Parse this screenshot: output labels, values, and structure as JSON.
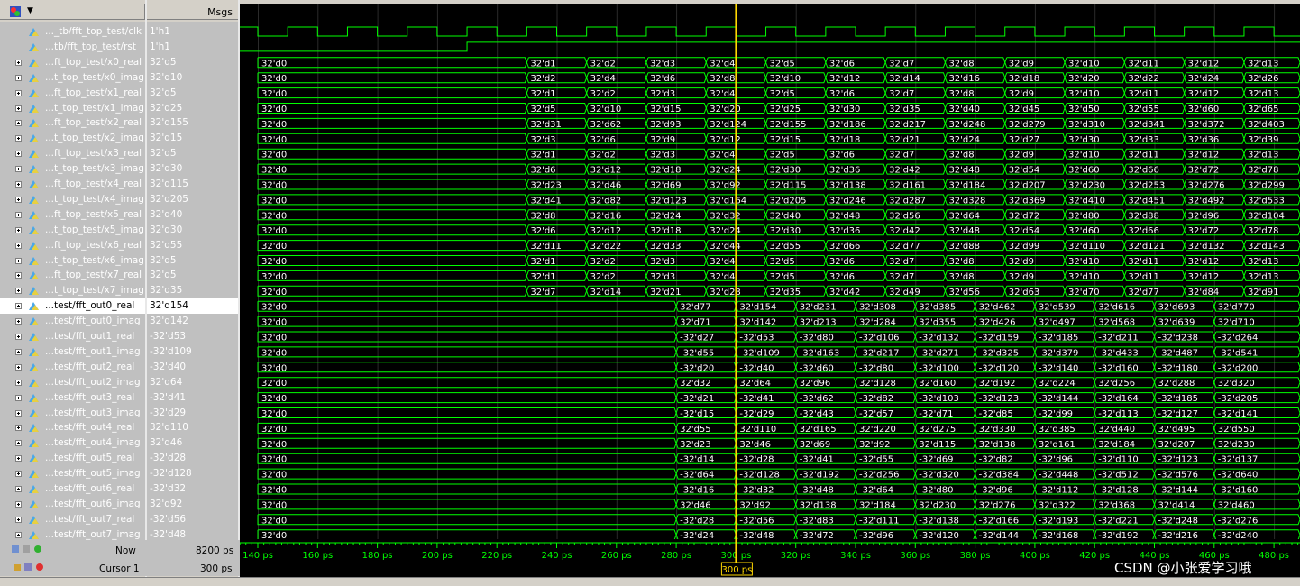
{
  "header": {
    "msgs_label": "Msgs"
  },
  "signals": [
    {
      "name": "..._tb/fft_top_test/clk",
      "value": "1'h1",
      "expandable": false
    },
    {
      "name": "...tb/fft_top_test/rst",
      "value": "1'h1",
      "expandable": false
    },
    {
      "name": "...ft_top_test/x0_real",
      "value": "32'd5",
      "expandable": true
    },
    {
      "name": "...t_top_test/x0_imag",
      "value": "32'd10",
      "expandable": true
    },
    {
      "name": "...ft_top_test/x1_real",
      "value": "32'd5",
      "expandable": true
    },
    {
      "name": "...t_top_test/x1_imag",
      "value": "32'd25",
      "expandable": true
    },
    {
      "name": "...ft_top_test/x2_real",
      "value": "32'd155",
      "expandable": true
    },
    {
      "name": "...t_top_test/x2_imag",
      "value": "32'd15",
      "expandable": true
    },
    {
      "name": "...ft_top_test/x3_real",
      "value": "32'd5",
      "expandable": true
    },
    {
      "name": "...t_top_test/x3_imag",
      "value": "32'd30",
      "expandable": true
    },
    {
      "name": "...ft_top_test/x4_real",
      "value": "32'd115",
      "expandable": true
    },
    {
      "name": "...t_top_test/x4_imag",
      "value": "32'd205",
      "expandable": true
    },
    {
      "name": "...ft_top_test/x5_real",
      "value": "32'd40",
      "expandable": true
    },
    {
      "name": "...t_top_test/x5_imag",
      "value": "32'd30",
      "expandable": true
    },
    {
      "name": "...ft_top_test/x6_real",
      "value": "32'd55",
      "expandable": true
    },
    {
      "name": "...t_top_test/x6_imag",
      "value": "32'd5",
      "expandable": true
    },
    {
      "name": "...ft_top_test/x7_real",
      "value": "32'd5",
      "expandable": true
    },
    {
      "name": "...t_top_test/x7_imag",
      "value": "32'd35",
      "expandable": true
    },
    {
      "name": "...test/fft_out0_real",
      "value": "32'd154",
      "expandable": true,
      "selected": true
    },
    {
      "name": "...test/fft_out0_imag",
      "value": "32'd142",
      "expandable": true
    },
    {
      "name": "...test/fft_out1_real",
      "value": "-32'd53",
      "expandable": true
    },
    {
      "name": "...test/fft_out1_imag",
      "value": "-32'd109",
      "expandable": true
    },
    {
      "name": "...test/fft_out2_real",
      "value": "-32'd40",
      "expandable": true
    },
    {
      "name": "...test/fft_out2_imag",
      "value": "32'd64",
      "expandable": true
    },
    {
      "name": "...test/fft_out3_real",
      "value": "-32'd41",
      "expandable": true
    },
    {
      "name": "...test/fft_out3_imag",
      "value": "-32'd29",
      "expandable": true
    },
    {
      "name": "...test/fft_out4_real",
      "value": "32'd110",
      "expandable": true
    },
    {
      "name": "...test/fft_out4_imag",
      "value": "32'd46",
      "expandable": true
    },
    {
      "name": "...test/fft_out5_real",
      "value": "-32'd28",
      "expandable": true
    },
    {
      "name": "...test/fft_out5_imag",
      "value": "-32'd128",
      "expandable": true
    },
    {
      "name": "...test/fft_out6_real",
      "value": "-32'd32",
      "expandable": true
    },
    {
      "name": "...test/fft_out6_imag",
      "value": "32'd92",
      "expandable": true
    },
    {
      "name": "...test/fft_out7_real",
      "value": "-32'd56",
      "expandable": true
    },
    {
      "name": "...test/fft_out7_imag",
      "value": "-32'd48",
      "expandable": true
    }
  ],
  "wave_values": {
    "x0_real": [
      "32'd1",
      "32'd2",
      "32'd3",
      "32'd4",
      "32'd5",
      "32'd6",
      "32'd7",
      "32'd8",
      "32'd9",
      "32'd10",
      "32'd11",
      "32'd12",
      "32'd13"
    ],
    "x0_imag": [
      "32'd2",
      "32'd4",
      "32'd6",
      "32'd8",
      "32'd10",
      "32'd12",
      "32'd14",
      "32'd16",
      "32'd18",
      "32'd20",
      "32'd22",
      "32'd24",
      "32'd26"
    ],
    "x1_real": [
      "32'd1",
      "32'd2",
      "32'd3",
      "32'd4",
      "32'd5",
      "32'd6",
      "32'd7",
      "32'd8",
      "32'd9",
      "32'd10",
      "32'd11",
      "32'd12",
      "32'd13"
    ],
    "x1_imag": [
      "32'd5",
      "32'd10",
      "32'd15",
      "32'd20",
      "32'd25",
      "32'd30",
      "32'd35",
      "32'd40",
      "32'd45",
      "32'd50",
      "32'd55",
      "32'd60",
      "32'd65"
    ],
    "x2_real": [
      "32'd31",
      "32'd62",
      "32'd93",
      "32'd124",
      "32'd155",
      "32'd186",
      "32'd217",
      "32'd248",
      "32'd279",
      "32'd310",
      "32'd341",
      "32'd372",
      "32'd403"
    ],
    "x2_imag": [
      "32'd3",
      "32'd6",
      "32'd9",
      "32'd12",
      "32'd15",
      "32'd18",
      "32'd21",
      "32'd24",
      "32'd27",
      "32'd30",
      "32'd33",
      "32'd36",
      "32'd39"
    ],
    "x3_real": [
      "32'd1",
      "32'd2",
      "32'd3",
      "32'd4",
      "32'd5",
      "32'd6",
      "32'd7",
      "32'd8",
      "32'd9",
      "32'd10",
      "32'd11",
      "32'd12",
      "32'd13"
    ],
    "x3_imag": [
      "32'd6",
      "32'd12",
      "32'd18",
      "32'd24",
      "32'd30",
      "32'd36",
      "32'd42",
      "32'd48",
      "32'd54",
      "32'd60",
      "32'd66",
      "32'd72",
      "32'd78"
    ],
    "x4_real": [
      "32'd23",
      "32'd46",
      "32'd69",
      "32'd92",
      "32'd115",
      "32'd138",
      "32'd161",
      "32'd184",
      "32'd207",
      "32'd230",
      "32'd253",
      "32'd276",
      "32'd299"
    ],
    "x4_imag": [
      "32'd41",
      "32'd82",
      "32'd123",
      "32'd164",
      "32'd205",
      "32'd246",
      "32'd287",
      "32'd328",
      "32'd369",
      "32'd410",
      "32'd451",
      "32'd492",
      "32'd533"
    ],
    "x5_real": [
      "32'd8",
      "32'd16",
      "32'd24",
      "32'd32",
      "32'd40",
      "32'd48",
      "32'd56",
      "32'd64",
      "32'd72",
      "32'd80",
      "32'd88",
      "32'd96",
      "32'd104"
    ],
    "x5_imag": [
      "32'd6",
      "32'd12",
      "32'd18",
      "32'd24",
      "32'd30",
      "32'd36",
      "32'd42",
      "32'd48",
      "32'd54",
      "32'd60",
      "32'd66",
      "32'd72",
      "32'd78"
    ],
    "x6_real": [
      "32'd11",
      "32'd22",
      "32'd33",
      "32'd44",
      "32'd55",
      "32'd66",
      "32'd77",
      "32'd88",
      "32'd99",
      "32'd110",
      "32'd121",
      "32'd132",
      "32'd143"
    ],
    "x6_imag": [
      "32'd1",
      "32'd2",
      "32'd3",
      "32'd4",
      "32'd5",
      "32'd6",
      "32'd7",
      "32'd8",
      "32'd9",
      "32'd10",
      "32'd11",
      "32'd12",
      "32'd13"
    ],
    "x7_real": [
      "32'd1",
      "32'd2",
      "32'd3",
      "32'd4",
      "32'd5",
      "32'd6",
      "32'd7",
      "32'd8",
      "32'd9",
      "32'd10",
      "32'd11",
      "32'd12",
      "32'd13"
    ],
    "x7_imag": [
      "32'd7",
      "32'd14",
      "32'd21",
      "32'd28",
      "32'd35",
      "32'd42",
      "32'd49",
      "32'd56",
      "32'd63",
      "32'd70",
      "32'd77",
      "32'd84",
      "32'd91"
    ],
    "out0_real": [
      "32'd77",
      "32'd154",
      "32'd231",
      "32'd308",
      "32'd385",
      "32'd462",
      "32'd539",
      "32'd616",
      "32'd693",
      "32'd770"
    ],
    "out0_imag": [
      "32'd71",
      "32'd142",
      "32'd213",
      "32'd284",
      "32'd355",
      "32'd426",
      "32'd497",
      "32'd568",
      "32'd639",
      "32'd710"
    ],
    "out1_real": [
      "-32'd27",
      "-32'd53",
      "-32'd80",
      "-32'd106",
      "-32'd132",
      "-32'd159",
      "-32'd185",
      "-32'd211",
      "-32'd238",
      "-32'd264"
    ],
    "out1_imag": [
      "-32'd55",
      "-32'd109",
      "-32'd163",
      "-32'd217",
      "-32'd271",
      "-32'd325",
      "-32'd379",
      "-32'd433",
      "-32'd487",
      "-32'd541"
    ],
    "out2_real": [
      "-32'd20",
      "-32'd40",
      "-32'd60",
      "-32'd80",
      "-32'd100",
      "-32'd120",
      "-32'd140",
      "-32'd160",
      "-32'd180",
      "-32'd200"
    ],
    "out2_imag": [
      "32'd32",
      "32'd64",
      "32'd96",
      "32'd128",
      "32'd160",
      "32'd192",
      "32'd224",
      "32'd256",
      "32'd288",
      "32'd320"
    ],
    "out3_real": [
      "-32'd21",
      "-32'd41",
      "-32'd62",
      "-32'd82",
      "-32'd103",
      "-32'd123",
      "-32'd144",
      "-32'd164",
      "-32'd185",
      "-32'd205"
    ],
    "out3_imag": [
      "-32'd15",
      "-32'd29",
      "-32'd43",
      "-32'd57",
      "-32'd71",
      "-32'd85",
      "-32'd99",
      "-32'd113",
      "-32'd127",
      "-32'd141"
    ],
    "out4_real": [
      "32'd55",
      "32'd110",
      "32'd165",
      "32'd220",
      "32'd275",
      "32'd330",
      "32'd385",
      "32'd440",
      "32'd495",
      "32'd550"
    ],
    "out4_imag": [
      "32'd23",
      "32'd46",
      "32'd69",
      "32'd92",
      "32'd115",
      "32'd138",
      "32'd161",
      "32'd184",
      "32'd207",
      "32'd230"
    ],
    "out5_real": [
      "-32'd14",
      "-32'd28",
      "-32'd41",
      "-32'd55",
      "-32'd69",
      "-32'd82",
      "-32'd96",
      "-32'd110",
      "-32'd123",
      "-32'd137"
    ],
    "out5_imag": [
      "-32'd64",
      "-32'd128",
      "-32'd192",
      "-32'd256",
      "-32'd320",
      "-32'd384",
      "-32'd448",
      "-32'd512",
      "-32'd576",
      "-32'd640"
    ],
    "out6_real": [
      "-32'd16",
      "-32'd32",
      "-32'd48",
      "-32'd64",
      "-32'd80",
      "-32'd96",
      "-32'd112",
      "-32'd128",
      "-32'd144",
      "-32'd160"
    ],
    "out6_imag": [
      "32'd46",
      "32'd92",
      "32'd138",
      "32'd184",
      "32'd230",
      "32'd276",
      "32'd322",
      "32'd368",
      "32'd414",
      "32'd460"
    ],
    "out7_real": [
      "-32'd28",
      "-32'd56",
      "-32'd83",
      "-32'd111",
      "-32'd138",
      "-32'd166",
      "-32'd193",
      "-32'd221",
      "-32'd248",
      "-32'd276"
    ],
    "out7_imag": [
      "-32'd24",
      "-32'd48",
      "-32'd72",
      "-32'd96",
      "-32'd120",
      "-32'd144",
      "-32'd168",
      "-32'd192",
      "-32'd216",
      "-32'd240"
    ]
  },
  "initial_value": "32'd0",
  "timeline_labels": [
    "140 ps",
    "160 ps",
    "180 ps",
    "200 ps",
    "220 ps",
    "240 ps",
    "260 ps",
    "280 ps",
    "300 ps",
    "320 ps",
    "340 ps",
    "360 ps",
    "380 ps",
    "400 ps",
    "420 ps",
    "440 ps",
    "460 ps",
    "480 ps"
  ],
  "status": {
    "now_label": "Now",
    "now_value": "8200 ps",
    "cursor_label": "Cursor 1",
    "cursor_value": "300 ps",
    "cursor_flag": "300 ps"
  },
  "watermark": "CSDN @小张爱学习哦",
  "colors": {
    "wave": "#00ff00",
    "cursor": "#ffd700",
    "text": "#ffffff"
  }
}
